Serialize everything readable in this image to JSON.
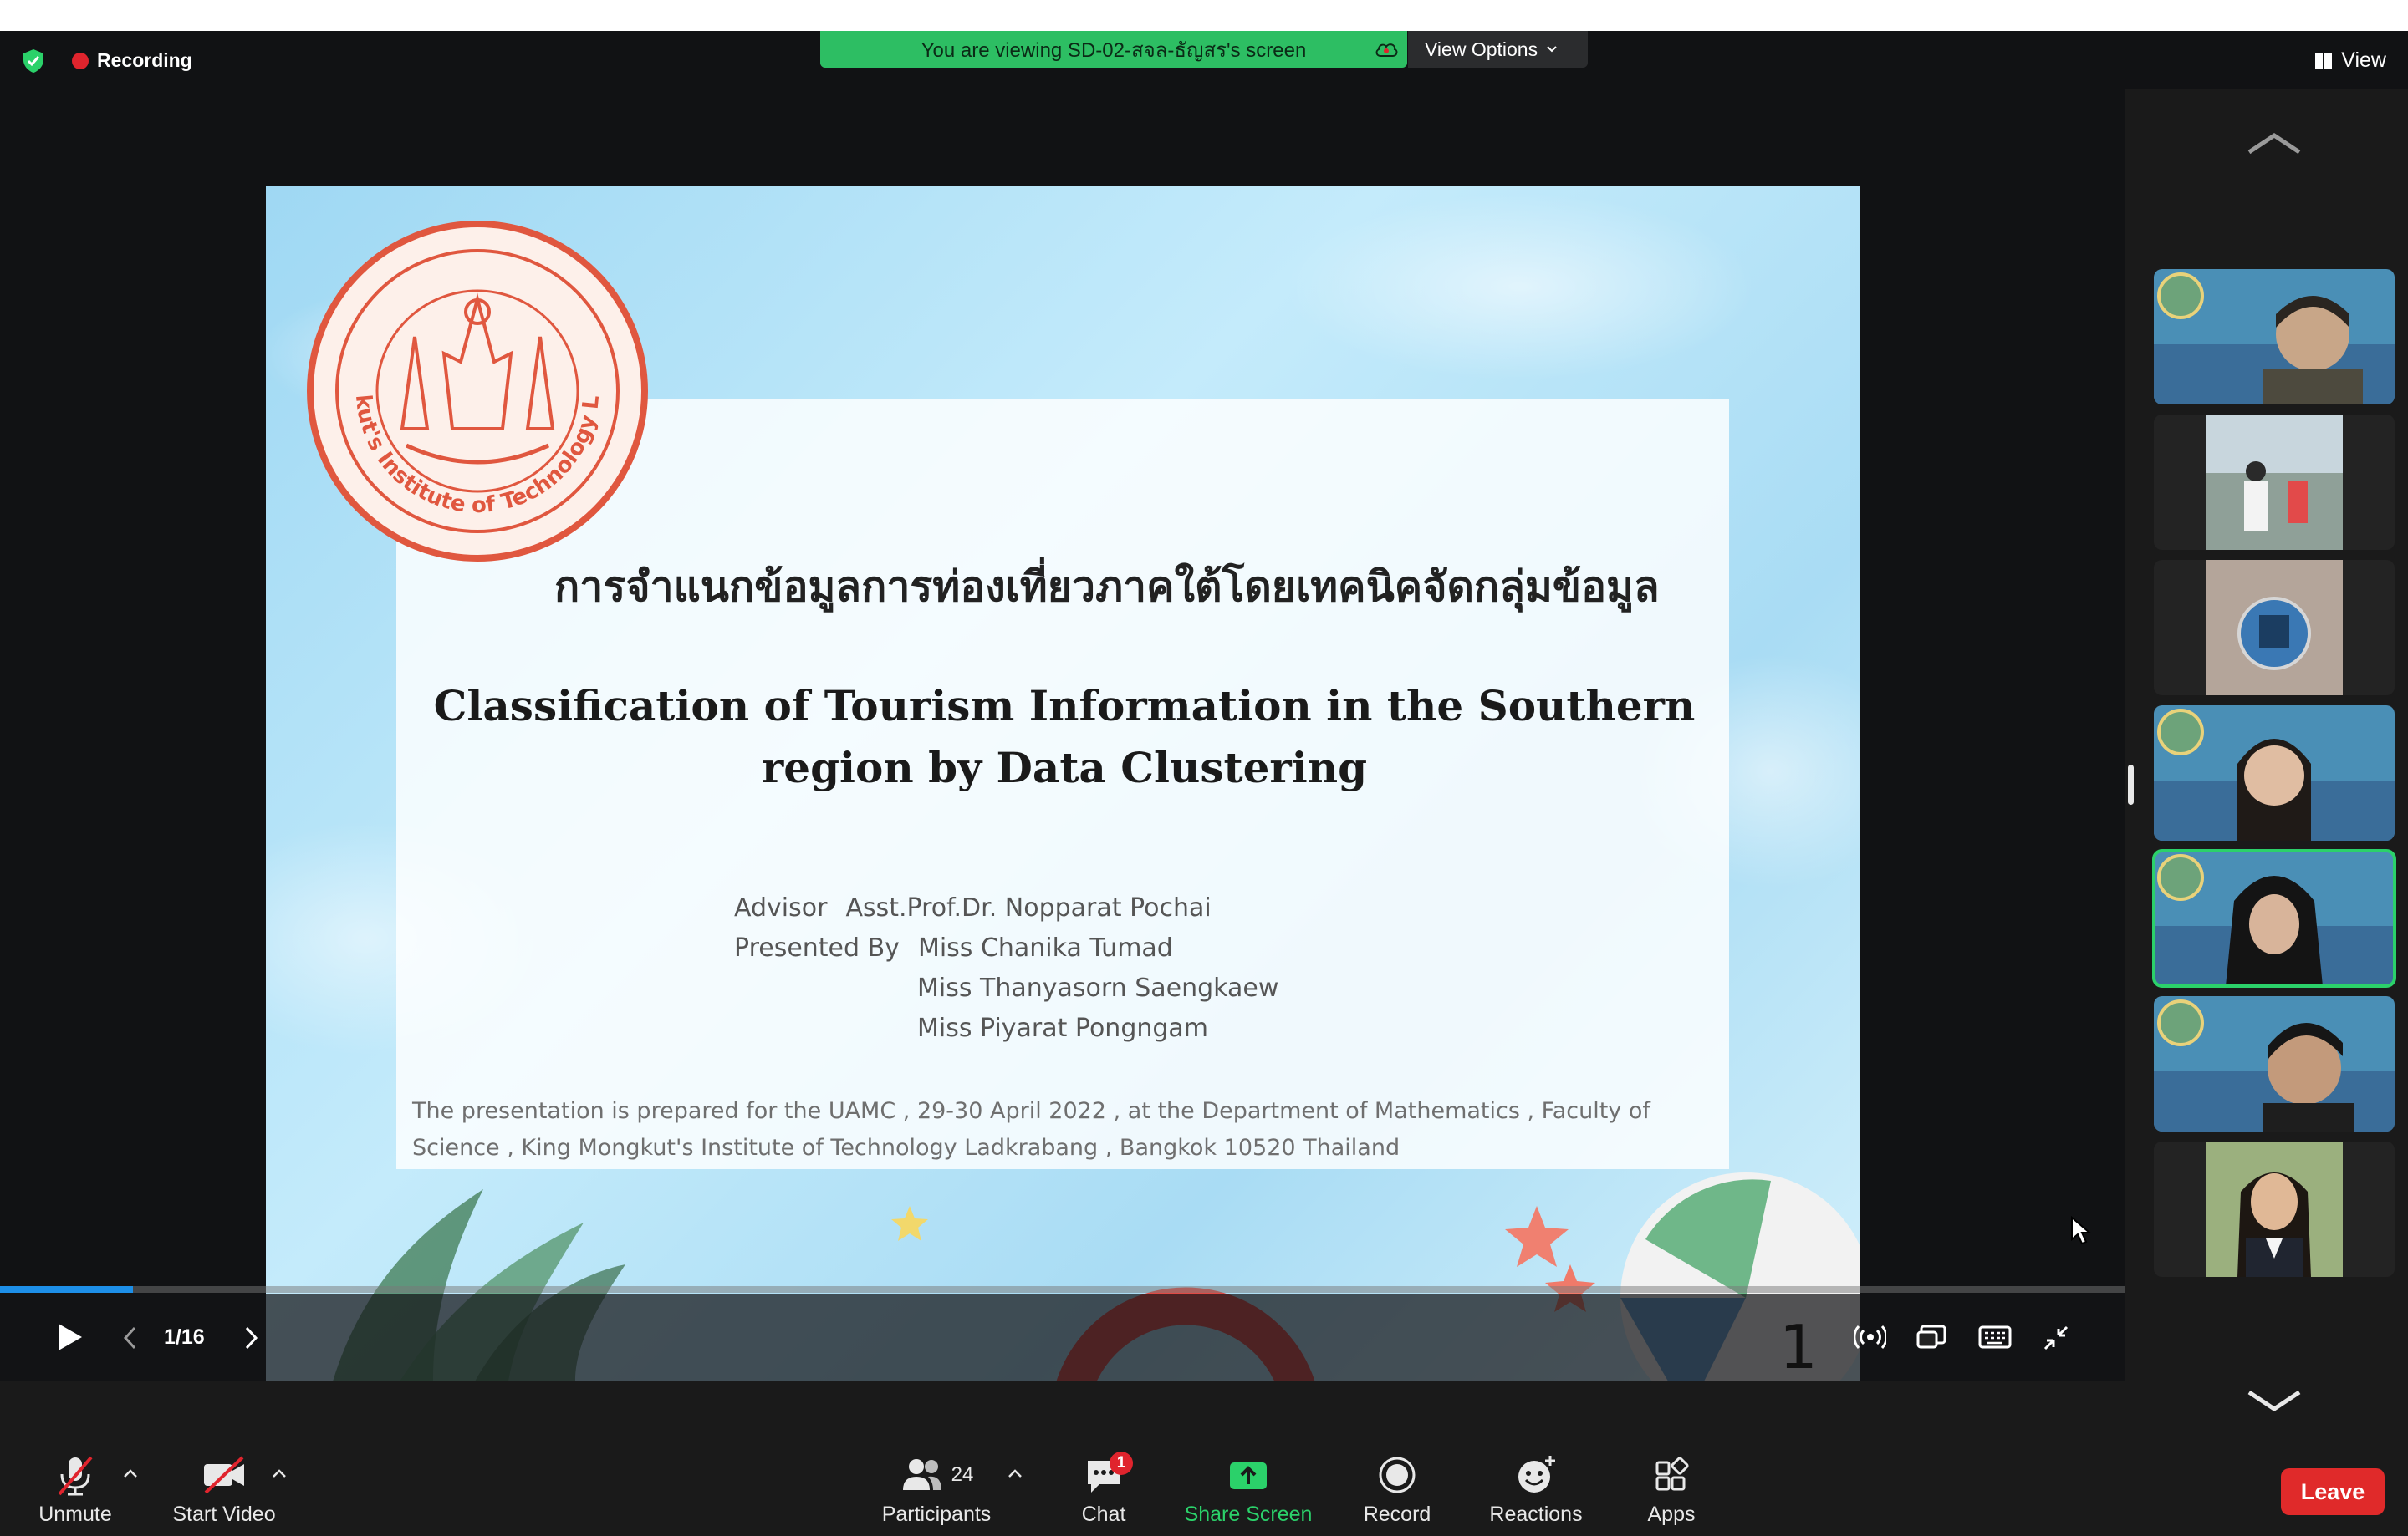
{
  "recording": {
    "label": "Recording"
  },
  "banner": {
    "text": "You are viewing SD-02-สจล-ธัญสร's screen"
  },
  "view_options": {
    "label": "View Options"
  },
  "view_button": {
    "label": "View"
  },
  "slide": {
    "thai_title": "การจำแนกข้อมูลการท่องเที่ยวภาคใต้โดยเทคนิคจัดกลุ่มข้อมูล",
    "english_title_line1": "Classification of Tourism Information in the Southern",
    "english_title_line2": "region by Data Clustering",
    "advisor_label": "Advisor",
    "advisor_name": "Asst.Prof.Dr. Nopparat Pochai",
    "presented_label": "Presented By",
    "presenters": [
      "Miss Chanika Tumad",
      "Miss Thanyasorn Saengkaew",
      "Miss Piyarat  Pongngam"
    ],
    "footnote_line1": "The presentation is prepared for the UAMC , 29-30  April 2022 , at the Department of Mathematics , Faculty of",
    "footnote_line2": "Science , King Mongkut's Institute of Technology Ladkrabang , Bangkok 10520 Thailand",
    "seal_text": "King Mongkut's Institute of Technology Ladkrabang",
    "slide_number": "1"
  },
  "slideshow": {
    "page_indicator": "1/16",
    "progress_fraction": 0.0625
  },
  "toolbar": {
    "unmute": "Unmute",
    "start_video": "Start Video",
    "participants": "Participants",
    "participants_count": "24",
    "chat": "Chat",
    "chat_badge": "1",
    "share_screen": "Share Screen",
    "record": "Record",
    "reactions": "Reactions",
    "apps": "Apps",
    "leave": "Leave"
  },
  "colors": {
    "accent_green": "#2bd16a",
    "leave_red": "#e02a2a",
    "record_red": "#e0242d",
    "banner_green": "#2dbe63"
  }
}
